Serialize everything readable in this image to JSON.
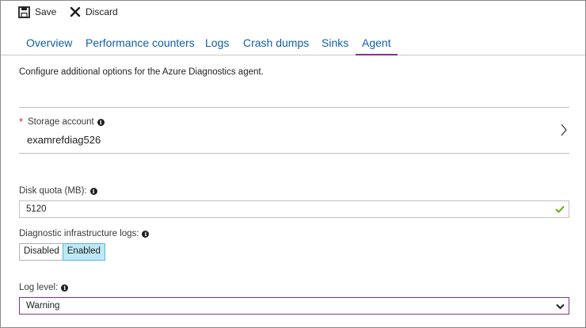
{
  "toolbar": {
    "save_label": "Save",
    "discard_label": "Discard"
  },
  "tabs": [
    {
      "label": "Overview"
    },
    {
      "label": "Performance counters"
    },
    {
      "label": "Logs"
    },
    {
      "label": "Crash dumps"
    },
    {
      "label": "Sinks"
    },
    {
      "label": "Agent",
      "active": true
    }
  ],
  "description": "Configure additional options for the Azure Diagnostics agent.",
  "storage_account": {
    "required_marker": "*",
    "label": "Storage account",
    "value": "examrefdiag526"
  },
  "disk_quota": {
    "label": "Disk quota (MB):",
    "value": "5120",
    "valid": true
  },
  "diagnostic_logs": {
    "label": "Diagnostic infrastructure logs:",
    "options": [
      "Disabled",
      "Enabled"
    ],
    "selected": "Enabled"
  },
  "log_level": {
    "label": "Log level:",
    "selected": "Warning"
  },
  "icons": {
    "info": "i",
    "save": "save-icon",
    "discard": "close-icon",
    "valid": "check-icon",
    "picker": "chevron-right-icon",
    "dropdown": "chevron-down-icon"
  },
  "colors": {
    "link": "#0f5fa8",
    "active_tab_underline": "#8a2d8f",
    "required": "#c4262e",
    "valid_check": "#57a300",
    "toggle_selected": "#bde9f7",
    "select_border": "#8a2d8f"
  }
}
